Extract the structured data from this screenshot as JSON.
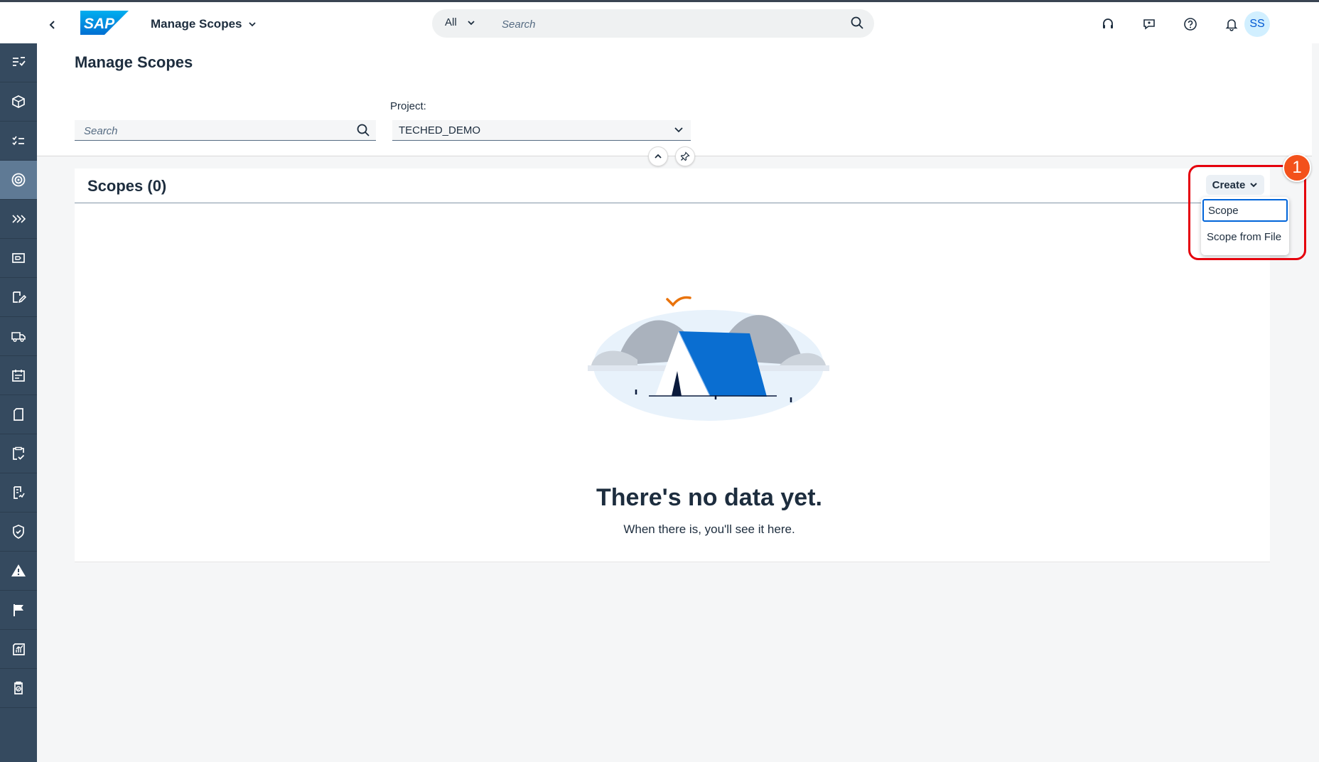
{
  "shell": {
    "app_title": "Manage Scopes",
    "logo_text": "SAP",
    "search_scope": "All",
    "search_placeholder": "Search",
    "avatar_initials": "SS"
  },
  "page": {
    "title": "Manage Scopes",
    "search_placeholder": "Search",
    "project_label": "Project:",
    "project_value": "TECHED_DEMO"
  },
  "panel": {
    "title": "Scopes (0)",
    "create_label": "Create",
    "menu_items": [
      "Scope",
      "Scope from File"
    ]
  },
  "empty_state": {
    "title": "There's no data yet.",
    "description": "When there is, you'll see it here."
  },
  "annotation": {
    "badge_number": "1"
  },
  "sidenav": {
    "icons": [
      "task-list-icon",
      "product-box-icon",
      "checklist-icon",
      "target-icon",
      "process-flow-icon",
      "label-icon",
      "edit-form-icon",
      "shipping-icon",
      "calendar-icon",
      "document-icon",
      "clipboard-check-icon",
      "test-checklist-icon",
      "shield-check-icon",
      "warning-icon",
      "flag-icon",
      "report-icon",
      "clipboard-badge-icon"
    ],
    "active_index": 3
  },
  "colors": {
    "shell_bg": "#ffffff",
    "sidenav_bg": "#354a5f",
    "sidenav_active": "#5f7a95",
    "accent": "#0064d9",
    "highlight_red": "#e5000c",
    "badge_orange": "#f3511b"
  }
}
